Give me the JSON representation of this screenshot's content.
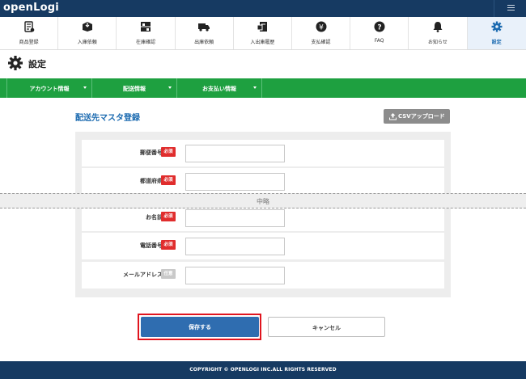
{
  "header": {
    "logo": "openLogi"
  },
  "nav": {
    "items": [
      {
        "label": "商品登録",
        "icon": "product-list-icon"
      },
      {
        "label": "入庫依頼",
        "icon": "box-in-icon"
      },
      {
        "label": "在庫確認",
        "icon": "shelf-icon"
      },
      {
        "label": "出庫依頼",
        "icon": "truck-icon"
      },
      {
        "label": "入出庫履歴",
        "icon": "history-box-icon"
      },
      {
        "label": "支払確認",
        "icon": "yen-coin-icon"
      },
      {
        "label": "FAQ",
        "icon": "question-icon"
      },
      {
        "label": "お知らせ",
        "icon": "bell-icon"
      },
      {
        "label": "設定",
        "icon": "gear-icon",
        "active": true
      }
    ]
  },
  "page": {
    "title": "設定"
  },
  "tabs": [
    {
      "label": "アカウント情報"
    },
    {
      "label": "配送情報"
    },
    {
      "label": "お支払い情報"
    }
  ],
  "section": {
    "title": "配送先マスタ登録",
    "csv_label": "CSVアップロード"
  },
  "form": {
    "fields": [
      {
        "label": "郵便番号",
        "badge": "必須",
        "required": true,
        "value": ""
      },
      {
        "label": "都道府県",
        "badge": "必須",
        "required": true,
        "value": ""
      },
      {
        "label": "お名前",
        "badge": "必須",
        "required": true,
        "value": ""
      },
      {
        "label": "電話番号",
        "badge": "必須",
        "required": true,
        "value": ""
      },
      {
        "label": "メールアドレス",
        "badge": "任意",
        "required": false,
        "value": ""
      }
    ],
    "omitted_label": "中略"
  },
  "actions": {
    "save_label": "保存する",
    "cancel_label": "キャンセル"
  },
  "footer": {
    "copyright": "COPYRIGHT © OPENLOGI INC.ALL RIGHTS RESERVED"
  },
  "colors": {
    "header_bg": "#163a62",
    "tab_green": "#1ea040",
    "accent_blue": "#1b6ab0",
    "required_red": "#e02d2d",
    "highlight_red": "#e0141e"
  }
}
